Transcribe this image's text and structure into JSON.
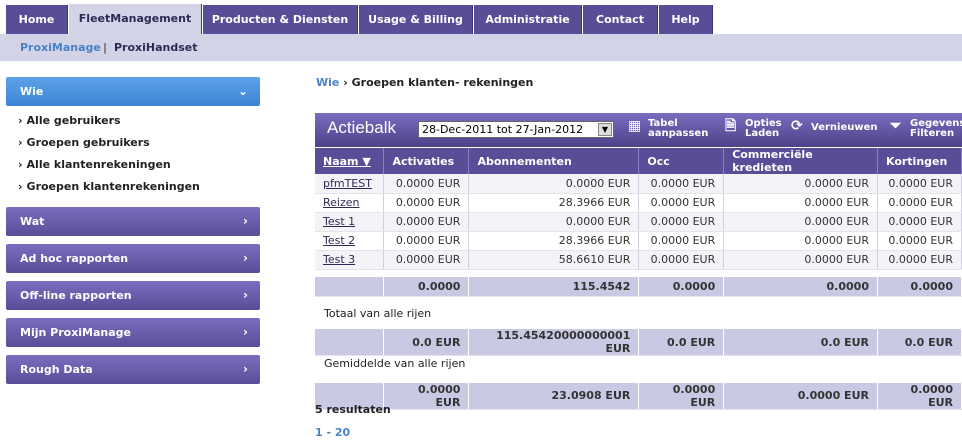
{
  "nav": {
    "tabs": [
      "Home",
      "FleetManagement",
      "Producten & Diensten",
      "Usage & Billing",
      "Administratie",
      "Contact",
      "Help"
    ],
    "active_tab": "FleetManagement",
    "sub": {
      "active": "ProxiManage",
      "sep": "|",
      "other": "ProxiHandset"
    }
  },
  "sidebar": {
    "wie": "Wie",
    "wie_links": [
      "Alle gebruikers",
      "Groepen gebruikers",
      "Alle klantenrekeningen",
      "Groepen klantenrekeningen"
    ],
    "blocks": [
      "Wat",
      "Ad hoc rapporten",
      "Off-line rapporten",
      "Mijn ProxiManage",
      "Rough Data"
    ]
  },
  "breadcrumb": {
    "link": "Wie",
    "sep": "›",
    "current": "Groepen klanten- rekeningen"
  },
  "actionbar": {
    "title": "Actiebalk",
    "date_range": "28-Dec-2011 tot 27-Jan-2012",
    "buttons": [
      {
        "line1": "Tabel",
        "line2": "aanpassen"
      },
      {
        "line1": "Opties",
        "line2": "Laden"
      },
      {
        "line1": "Vernieuwen",
        "line2": ""
      },
      {
        "line1": "Gegevens",
        "line2": "Filteren"
      }
    ]
  },
  "table": {
    "headers": [
      "Naam",
      "Activaties",
      "Abonnementen",
      "Occ",
      "Commerciële kredieten",
      "Kortingen"
    ],
    "sort_indicator": "▼",
    "rows": [
      [
        "pfmTEST",
        "0.0000 EUR",
        "0.0000 EUR",
        "0.0000 EUR",
        "0.0000 EUR",
        "0.0000 EUR"
      ],
      [
        "Reizen",
        "0.0000 EUR",
        "28.3966 EUR",
        "0.0000 EUR",
        "0.0000 EUR",
        "0.0000 EUR"
      ],
      [
        "Test 1",
        "0.0000 EUR",
        "0.0000 EUR",
        "0.0000 EUR",
        "0.0000 EUR",
        "0.0000 EUR"
      ],
      [
        "Test 2",
        "0.0000 EUR",
        "28.3966 EUR",
        "0.0000 EUR",
        "0.0000 EUR",
        "0.0000 EUR"
      ],
      [
        "Test 3",
        "0.0000 EUR",
        "58.6610 EUR",
        "0.0000 EUR",
        "0.0000 EUR",
        "0.0000 EUR"
      ]
    ],
    "subtotal": [
      "",
      "0.0000",
      "115.4542",
      "0.0000",
      "0.0000",
      "0.0000"
    ],
    "total_label": "Totaal van alle rijen",
    "total": [
      "",
      "0.0 EUR",
      "115.45420000000001 EUR",
      "0.0 EUR",
      "0.0 EUR",
      "0.0 EUR"
    ],
    "avg_label": "Gemiddelde van alle rijen",
    "avg": [
      "",
      "0.0000 EUR",
      "23.0908 EUR",
      "0.0000 EUR",
      "0.0000 EUR",
      "0.0000 EUR"
    ]
  },
  "results": "5 resultaten",
  "pager": "1 - 20"
}
